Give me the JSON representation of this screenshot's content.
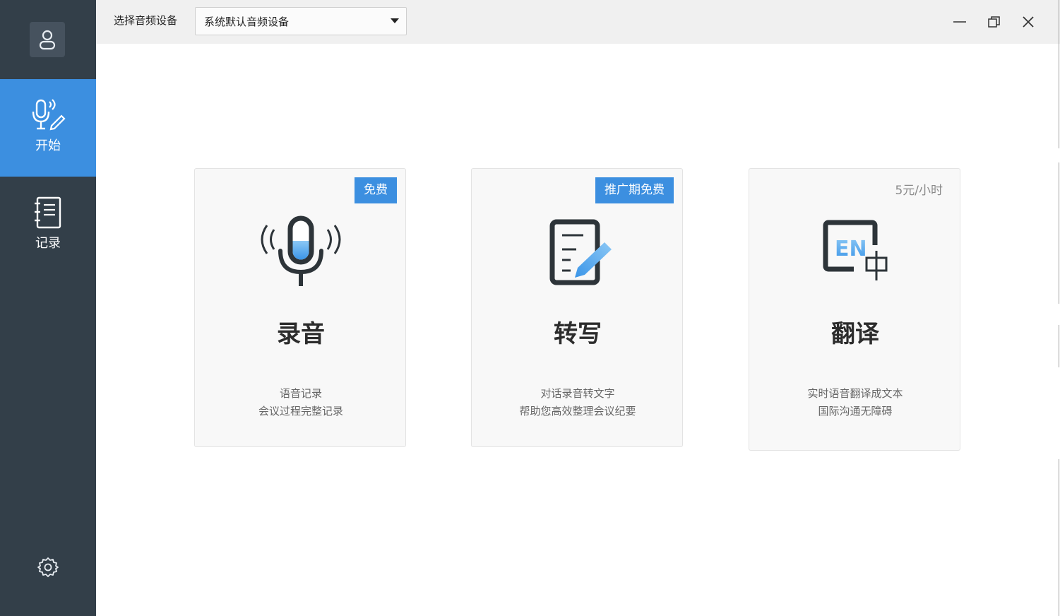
{
  "sidebar": {
    "avatar_icon": "user-icon",
    "items": [
      {
        "label": "开始",
        "icon": "microphone-pen-icon",
        "active": true
      },
      {
        "label": "记录",
        "icon": "notebook-icon",
        "active": false
      }
    ],
    "settings_icon": "gear-icon"
  },
  "titlebar": {
    "device_label": "选择音频设备",
    "device_value": "系统默认音频设备",
    "window_controls": [
      "minimize-icon",
      "restore-icon",
      "close-icon"
    ]
  },
  "cards": [
    {
      "title": "录音",
      "badge": "免费",
      "line1": "语音记录",
      "line2": "会议过程完整记录",
      "icon": "microphone-icon"
    },
    {
      "title": "转写",
      "badge": "推广期免费",
      "line1": "对话录音转文字",
      "line2": "帮助您高效整理会议纪要",
      "icon": "document-pen-icon"
    },
    {
      "title": "翻译",
      "price": "5元/小时",
      "line1": "实时语音翻译成文本",
      "line2": "国际沟通无障碍",
      "icon": "en-zh-translate-icon"
    }
  ],
  "colors": {
    "sidebar_bg": "#333f49",
    "accent": "#3c8fe0",
    "titlebar_bg": "#f0f0f0",
    "card_bg": "#f8f8f8"
  }
}
